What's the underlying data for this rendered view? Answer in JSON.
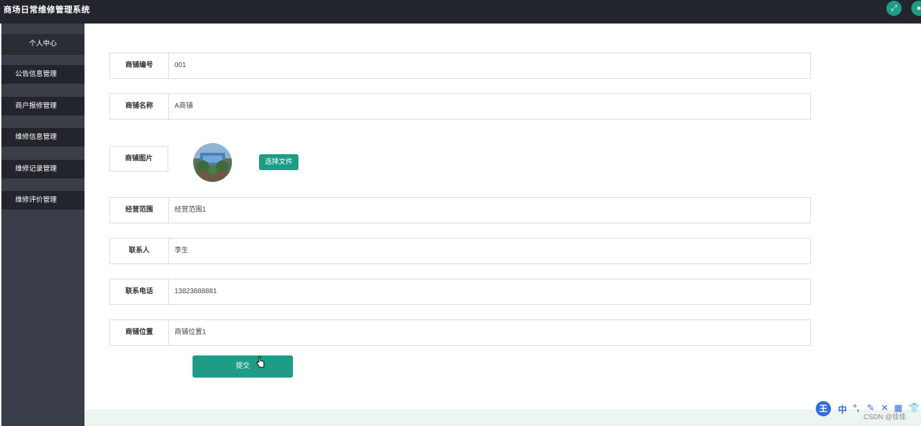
{
  "app": {
    "title": "商场日常维修管理系统"
  },
  "header": {
    "fullscreen_icon": "fullscreen-icon",
    "user_icon": "user-icon"
  },
  "sidebar": {
    "items": [
      {
        "label": "个人中心"
      },
      {
        "label": "公告信息管理"
      },
      {
        "label": "商户报修管理"
      },
      {
        "label": "维修信息管理"
      },
      {
        "label": "维修记录管理"
      },
      {
        "label": "维修评价管理"
      }
    ]
  },
  "form": {
    "shop_number": {
      "label": "商铺编号",
      "value": "001"
    },
    "shop_name": {
      "label": "商铺名称",
      "value": "A商铺"
    },
    "shop_image": {
      "label": "商铺图片",
      "choose_file_label": "选择文件"
    },
    "business_scope": {
      "label": "经营范围",
      "value": "经营范围1"
    },
    "contact_person": {
      "label": "联系人",
      "value": "李生"
    },
    "contact_phone": {
      "label": "联系电话",
      "value": "13823888881"
    },
    "shop_location": {
      "label": "商铺位置",
      "value": "商铺位置1"
    },
    "submit_label": "提交"
  },
  "ime": {
    "logo": "王",
    "mode": "中",
    "punct": "°,",
    "pen": "✎",
    "close": "✕",
    "keyboard": "▦",
    "shirt": "👕"
  },
  "watermark": "CSDN @佳佳"
}
